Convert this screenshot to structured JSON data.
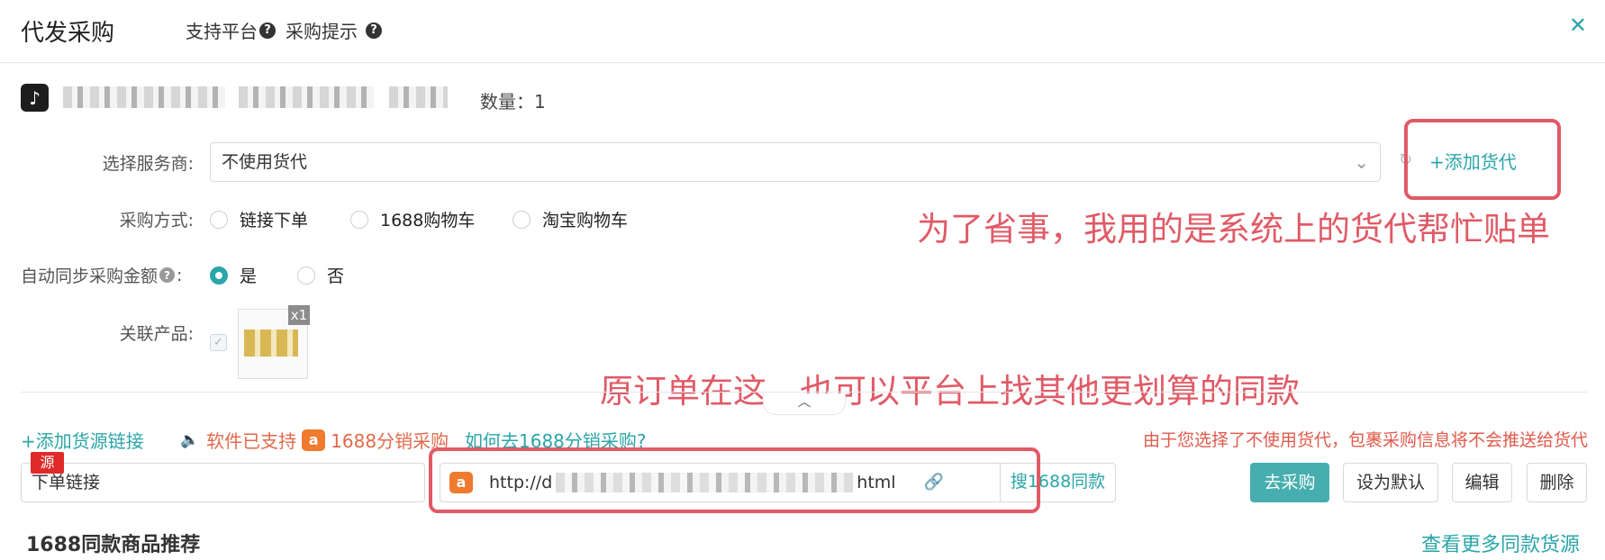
{
  "header": {
    "title": "代发采购",
    "tabs": [
      {
        "label": "支持平台"
      },
      {
        "label": "采购提示"
      }
    ],
    "help_glyph": "?",
    "close_glyph": "✕"
  },
  "product": {
    "platform_icon": "tiktok-icon",
    "quantity_label": "数量：1"
  },
  "form": {
    "service_label": "选择服务商:",
    "service_value": "不使用货代",
    "add_forwarder_label": "+添加货代",
    "method_label": "采购方式:",
    "method_options": [
      "链接下单",
      "1688购物车",
      "淘宝购物车"
    ],
    "auto_sync_label": "自动同步采购金额",
    "auto_sync_options": [
      "是",
      "否"
    ],
    "auto_sync_selected": "是",
    "related_label": "关联产品:",
    "related_qty": "x1"
  },
  "annotations": {
    "top": "为了省事，我用的是系统上的货代帮忙贴单",
    "middle": "原订单在这，也可以平台上找其他更划算的同款"
  },
  "source": {
    "add_label": "+添加货源链接",
    "support_text": "软件已支持",
    "support_platform": "1688分销采购",
    "howto_link": "如何去1688分销采购?",
    "notice": "由于您选择了不使用货代，包裹采购信息将不会推送给货代",
    "source_badge": "源",
    "link_label": "下单链接",
    "url_prefix": "http://d",
    "url_suffix": "html",
    "search_button": "搜1688同款",
    "go_button": "去采购",
    "default_button": "设为默认",
    "edit_button": "编辑",
    "delete_button": "删除"
  },
  "recommend": {
    "title": "1688同款商品推荐",
    "more": "查看更多同款货源"
  },
  "colors": {
    "accent": "#2aa5a8",
    "annotation": "#e05a66",
    "primary_button": "#46aeae",
    "warning": "#e05a4b"
  }
}
